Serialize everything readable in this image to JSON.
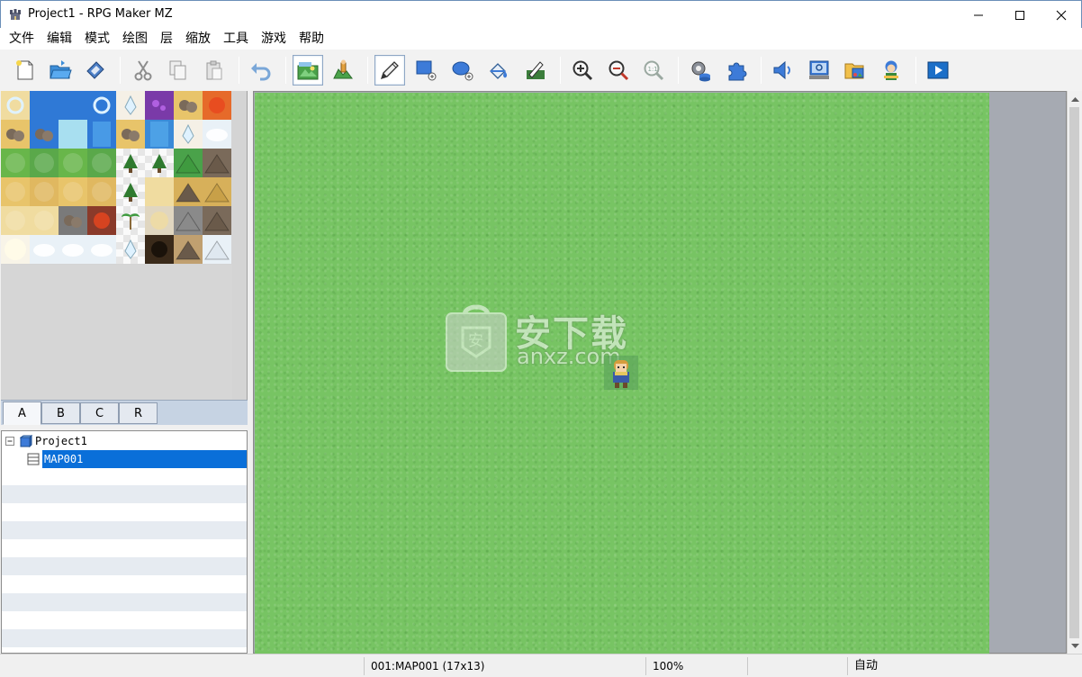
{
  "window": {
    "title": "Project1 - RPG Maker MZ",
    "icon": "rpgmaker-castle-icon"
  },
  "menu": {
    "items": [
      "文件",
      "编辑",
      "模式",
      "绘图",
      "层",
      "缩放",
      "工具",
      "游戏",
      "帮助"
    ]
  },
  "toolbar": {
    "buttons": [
      "new-project-icon",
      "open-project-icon",
      "save-project-icon",
      "cut-icon",
      "copy-icon",
      "paste-icon",
      "undo-icon",
      "map-mode-icon",
      "event-mode-icon",
      "pencil-icon",
      "rectangle-icon",
      "ellipse-icon",
      "flood-fill-icon",
      "shadow-pen-icon",
      "zoom-in-icon",
      "zoom-out-icon",
      "actual-size-icon",
      "database-icon",
      "plugin-manager-icon",
      "sound-test-icon",
      "event-searcher-icon",
      "resource-manager-icon",
      "character-generator-icon",
      "playtest-icon"
    ],
    "active": [
      "map-mode-icon",
      "pencil-icon"
    ]
  },
  "tileset": {
    "tabs": [
      "A",
      "B",
      "C",
      "R"
    ],
    "active_tab": "A"
  },
  "map_tree": {
    "project": "Project1",
    "maps": [
      "MAP001"
    ],
    "selected": "MAP001"
  },
  "watermark": {
    "main": "安下载",
    "sub": "anxz.com",
    "badge": "安"
  },
  "status": {
    "map": "001:MAP001 (17x13)",
    "zoom": "100%",
    "mode": "自动"
  },
  "colors": {
    "grass": "#77c463",
    "selection": "#0a6fd9",
    "map_bg": "#a6aab2"
  }
}
